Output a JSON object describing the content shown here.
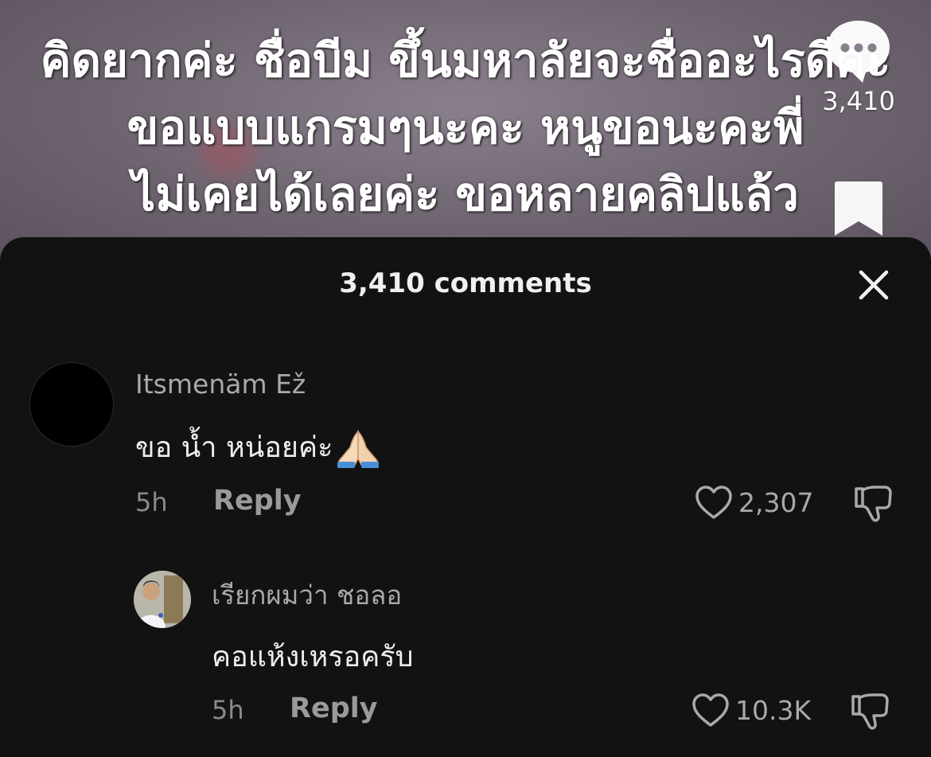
{
  "video": {
    "caption_lines": [
      "คิดยากค่ะ ชื่อบีม ขึ้นมหาลัยจะชื่ออะไรดีคะ",
      "ขอแบบแกรมๆนะคะ หนูขอนะคะพี่",
      "ไม่เคยได้เลยค่ะ ขอหลายคลิปแล้ว"
    ],
    "comment_count": "3,410",
    "comment_icon": "speech-bubble-icon",
    "bookmark_icon": "bookmark-icon"
  },
  "sheet": {
    "title": "3,410 comments",
    "close_icon": "close-icon"
  },
  "comments": [
    {
      "username": "Itsmenäm Ež",
      "text": "ขอ น้ำ หน่อยค่ะ",
      "emoji": "folded-hands-icon",
      "time": "5h",
      "reply_label": "Reply",
      "likes": "2,307"
    },
    {
      "username": "เรียกผมว่า ชอลอ",
      "text": "คอแห้งเหรอครับ",
      "time": "5h",
      "reply_label": "Reply",
      "likes": "10.3K"
    }
  ],
  "colors": {
    "sheet_bg": "#121212",
    "primary_text": "#ededed",
    "secondary_text": "#a9a9a9"
  }
}
